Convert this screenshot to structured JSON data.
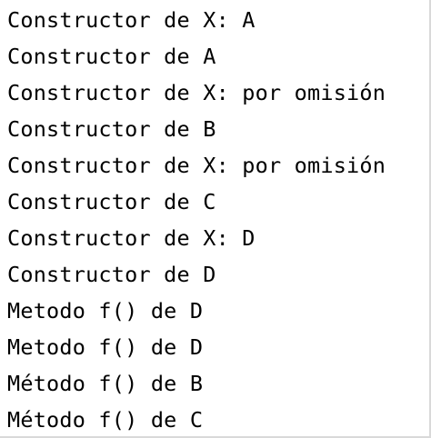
{
  "console": {
    "lines": [
      "Constructor de X: A",
      "Constructor de A",
      "Constructor de X: por omisión",
      "Constructor de B",
      "Constructor de X: por omisión",
      "Constructor de C",
      "Constructor de X: D",
      "Constructor de D",
      "Metodo f() de D",
      "Metodo f() de D",
      "Método f() de B",
      "Método f() de C"
    ]
  }
}
